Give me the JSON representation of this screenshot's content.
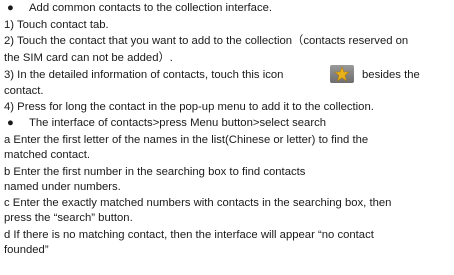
{
  "sections": [
    {
      "heading": "Add common contacts to the collection interface.",
      "steps": [
        "1)  Touch contact tab.",
        "2) Touch the contact that you want to add to the collection（contacts reserved on",
        "the SIM card can not be added）.",
        "3) In the detailed information of contacts, touch this icon",
        "besides the",
        "contact.",
        "4)  Press for long the contact in the pop-up menu to add it to the collection."
      ]
    },
    {
      "heading": "The interface of contacts>press Menu button>select search",
      "steps": [
        "a Enter the first letter of the names in the list(Chinese or letter) to find the",
        "matched contact.",
        "b Enter the first number in the searching box to find contacts",
        "named under numbers.",
        "c Enter the exactly matched numbers with contacts in the searching box, then",
        "press the “search” button.",
        "d If there is no matching contact, then the interface will appear “no contact",
        "founded”"
      ]
    }
  ],
  "icons": {
    "favorite": "star-icon"
  },
  "colors": {
    "text": "#1a1a1a",
    "icon_bg": "#7f7f7f",
    "star": "#e8b21c"
  }
}
